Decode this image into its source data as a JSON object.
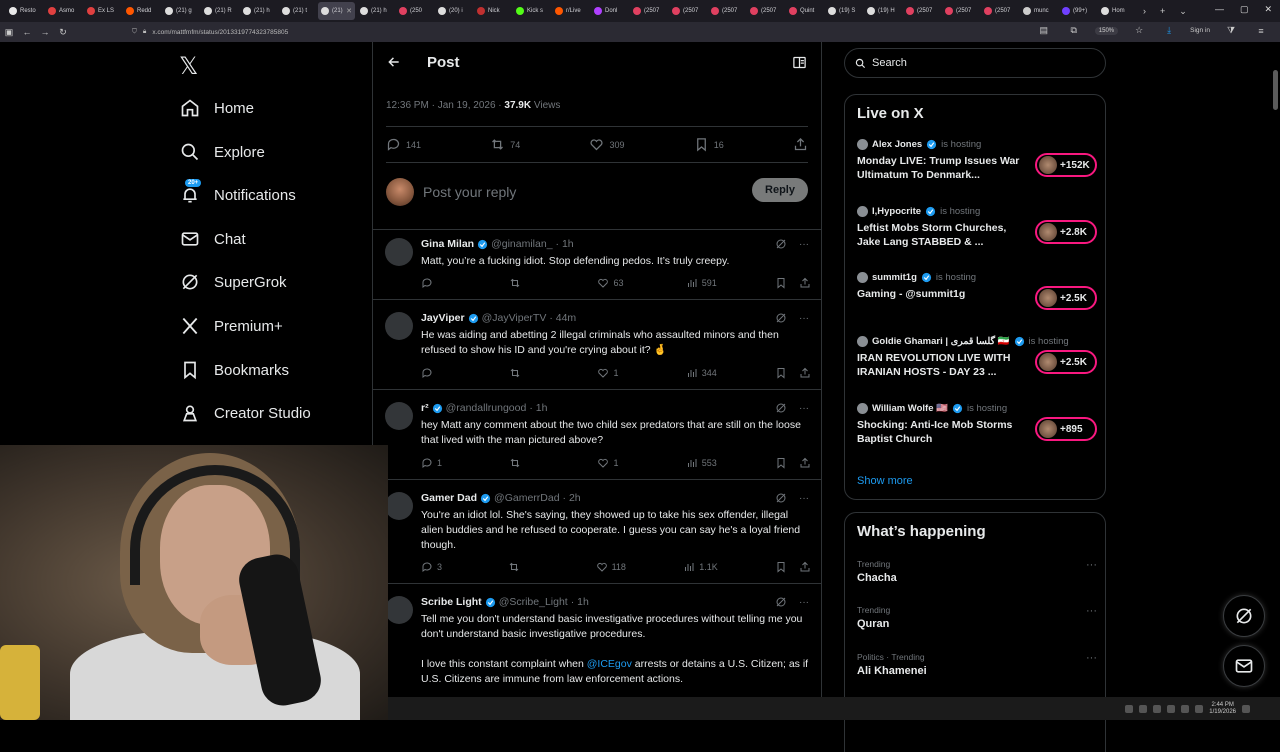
{
  "browser": {
    "tabs": [
      {
        "label": "Resto",
        "color": "#e8e8e8"
      },
      {
        "label": "Asmo",
        "color": "#e04040"
      },
      {
        "label": "Ex LS",
        "color": "#e04040"
      },
      {
        "label": "Redd",
        "color": "#ff5700"
      },
      {
        "label": "(21) g",
        "color": "#dddddd"
      },
      {
        "label": "(21) R",
        "color": "#dddddd"
      },
      {
        "label": "(21) h",
        "color": "#dddddd"
      },
      {
        "label": "(21) t",
        "color": "#dddddd"
      },
      {
        "label": "(21)",
        "color": "#dddddd"
      },
      {
        "label": "(21) h",
        "color": "#dddddd"
      },
      {
        "label": "(250",
        "color": "#e04060"
      },
      {
        "label": "(20) i",
        "color": "#dddddd"
      },
      {
        "label": "Nick",
        "color": "#c03030"
      },
      {
        "label": "Kick s",
        "color": "#53fc18"
      },
      {
        "label": "r/Live",
        "color": "#ff5700"
      },
      {
        "label": "Donl",
        "color": "#b040ff"
      },
      {
        "label": "(2507",
        "color": "#e04060"
      },
      {
        "label": "(2507",
        "color": "#e04060"
      },
      {
        "label": "(2507",
        "color": "#e04060"
      },
      {
        "label": "(2507",
        "color": "#e04060"
      },
      {
        "label": "Quint",
        "color": "#e04060"
      },
      {
        "label": "(19) S",
        "color": "#dddddd"
      },
      {
        "label": "(19) H",
        "color": "#dddddd"
      },
      {
        "label": "(2507",
        "color": "#e04060"
      },
      {
        "label": "(2507",
        "color": "#e04060"
      },
      {
        "label": "(2507",
        "color": "#e04060"
      },
      {
        "label": "munc",
        "color": "#cccccc"
      },
      {
        "label": "(99+)",
        "color": "#7040ff"
      },
      {
        "label": "Hom",
        "color": "#dddddd"
      }
    ],
    "active_tab_index": 8,
    "url": "x.com/mattfmfm/status/2013319774323785805",
    "zoom": "150%",
    "sign_in": "Sign in"
  },
  "sidebar": {
    "items": [
      {
        "label": "Home",
        "icon": "home-icon"
      },
      {
        "label": "Explore",
        "icon": "search-icon"
      },
      {
        "label": "Notifications",
        "icon": "bell-icon",
        "badge": "20+"
      },
      {
        "label": "Chat",
        "icon": "mail-icon"
      },
      {
        "label": "SuperGrok",
        "icon": "grok-icon"
      },
      {
        "label": "Premium+",
        "icon": "x-logo-icon"
      },
      {
        "label": "Bookmarks",
        "icon": "bookmark-icon"
      },
      {
        "label": "Creator Studio",
        "icon": "creator-icon"
      }
    ]
  },
  "post": {
    "header_title": "Post",
    "timestamp": "12:36 PM · Jan 19, 2026 · ",
    "views_count": "37.9K",
    "views_label": " Views",
    "replies": "141",
    "reposts": "74",
    "likes": "309",
    "bookmarks": "16",
    "reply_placeholder": "Post your reply",
    "reply_button": "Reply"
  },
  "comments": [
    {
      "name": "Gina Milan",
      "handle": "@ginamilan_",
      "time": "· 1h",
      "text": "Matt, you’re a fucking idiot. Stop defending pedos. It’s truly creepy.",
      "replies": "",
      "reposts": "",
      "likes": "63",
      "views": "591"
    },
    {
      "name": "JayViper",
      "handle": "@JayViperTV",
      "time": "· 44m",
      "text": "He was aiding and abetting 2 illegal criminals who assaulted minors and then refused to show his ID and you're crying about it? 🤞",
      "replies": "",
      "reposts": "",
      "likes": "1",
      "views": "344"
    },
    {
      "name": "r²",
      "handle": "@randallrungood",
      "time": "· 1h",
      "text": "hey Matt any comment about the two child sex predators that are still on the loose that lived with the man pictured above?",
      "replies": "1",
      "reposts": "",
      "likes": "1",
      "views": "553"
    },
    {
      "name": "Gamer Dad",
      "handle": "@GamerrDad",
      "time": "· 2h",
      "text": "You're an idiot lol.  She's saying, they showed up to take his sex offender, illegal alien buddies and he refused to cooperate. I guess you can say he's a loyal friend though.",
      "replies": "3",
      "reposts": "",
      "likes": "118",
      "views": "1.1K"
    },
    {
      "name": "Scribe Light",
      "handle": "@Scribe_Light",
      "time": "· 1h",
      "text_1": "Tell me you don't understand basic investigative procedures without telling me you don't understand basic investigative procedures.",
      "text_2a": "I love this constant complaint when ",
      "text_2_link": "@ICEgov",
      "text_2b": " arrests or detains a U.S. Citizen; as if U.S. Citizens are immune from law enforcement actions."
    }
  ],
  "right": {
    "search_placeholder": "Search",
    "live_title": "Live on X",
    "is_hosting": "is hosting",
    "live": [
      {
        "host": "Alex Jones",
        "title": "Monday LIVE: Trump Issues War Ultimatum To Denmark...",
        "count": "+152K"
      },
      {
        "host": "I,Hypocrite",
        "title": "Leftist Mobs Storm Churches, Jake Lang STABBED & ...",
        "count": "+2.8K"
      },
      {
        "host": "summit1g",
        "title": "Gaming - @summit1g",
        "count": "+2.5K"
      },
      {
        "host": "Goldie Ghamari | گلسا قمری 🇮🇷",
        "title": "IRAN REVOLUTION LIVE WITH IRANIAN HOSTS - DAY 23 ...",
        "count": "+2.5K"
      },
      {
        "host": "William Wolfe 🇺🇸",
        "title": "Shocking: Anti-Ice Mob Storms Baptist Church",
        "count": "+895"
      }
    ],
    "show_more": "Show more",
    "happening_title": "What’s happening",
    "trends": [
      {
        "label": "Trending",
        "name": "Chacha"
      },
      {
        "label": "Trending",
        "name": "Quran"
      },
      {
        "label": "Politics · Trending",
        "name": "Ali Khamenei"
      }
    ]
  },
  "taskbar": {
    "time": "2:44 PM",
    "date": "1/19/2026"
  },
  "colors": {
    "accent": "#1d9bf0",
    "live_ring": "#f91880",
    "background": "#000000",
    "border": "#2f3336"
  }
}
